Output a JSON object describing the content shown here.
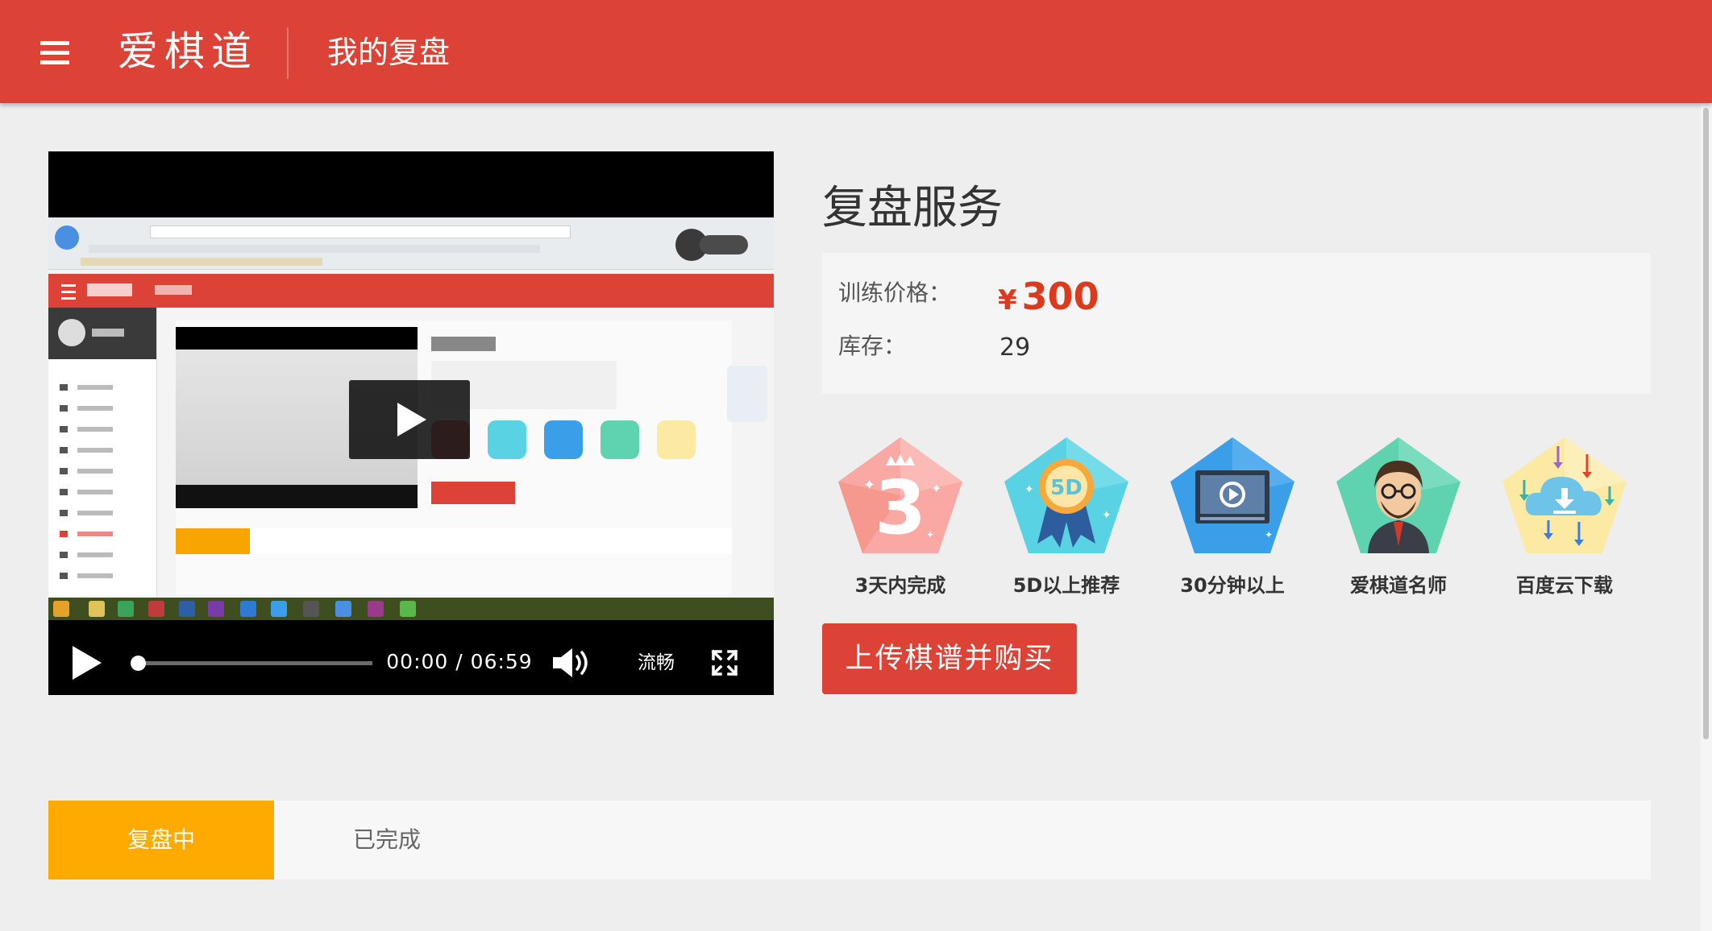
{
  "header": {
    "brand": "爱棋道",
    "title": "我的复盘",
    "bg_color": "#dc4236"
  },
  "video": {
    "current_time": "00:00",
    "separator": "/",
    "duration": "06:59",
    "quality": "流畅",
    "progress": 0
  },
  "service": {
    "title": "复盘服务",
    "price_label": "训练价格：",
    "price_currency": "¥",
    "price_value": "300",
    "stock_label": "库存：",
    "stock_value": "29",
    "price_color": "#dc3a1c"
  },
  "features": [
    {
      "label": "3天内完成",
      "icon": "three-days-badge-icon",
      "color": "#f9a8a4"
    },
    {
      "label": "5D以上推荐",
      "icon": "5d-ribbon-badge-icon",
      "color": "#59d2e3"
    },
    {
      "label": "30分钟以上",
      "icon": "video-player-badge-icon",
      "color": "#3b9ee8"
    },
    {
      "label": "爱棋道名师",
      "icon": "teacher-avatar-badge-icon",
      "color": "#5fd3b0"
    },
    {
      "label": "百度云下载",
      "icon": "cloud-download-badge-icon",
      "color": "#fbe9a4"
    }
  ],
  "buy_button": "上传棋谱并购买",
  "tabs": [
    {
      "label": "复盘中",
      "active": true,
      "color": "#ffaa00"
    },
    {
      "label": "已完成",
      "active": false
    }
  ]
}
